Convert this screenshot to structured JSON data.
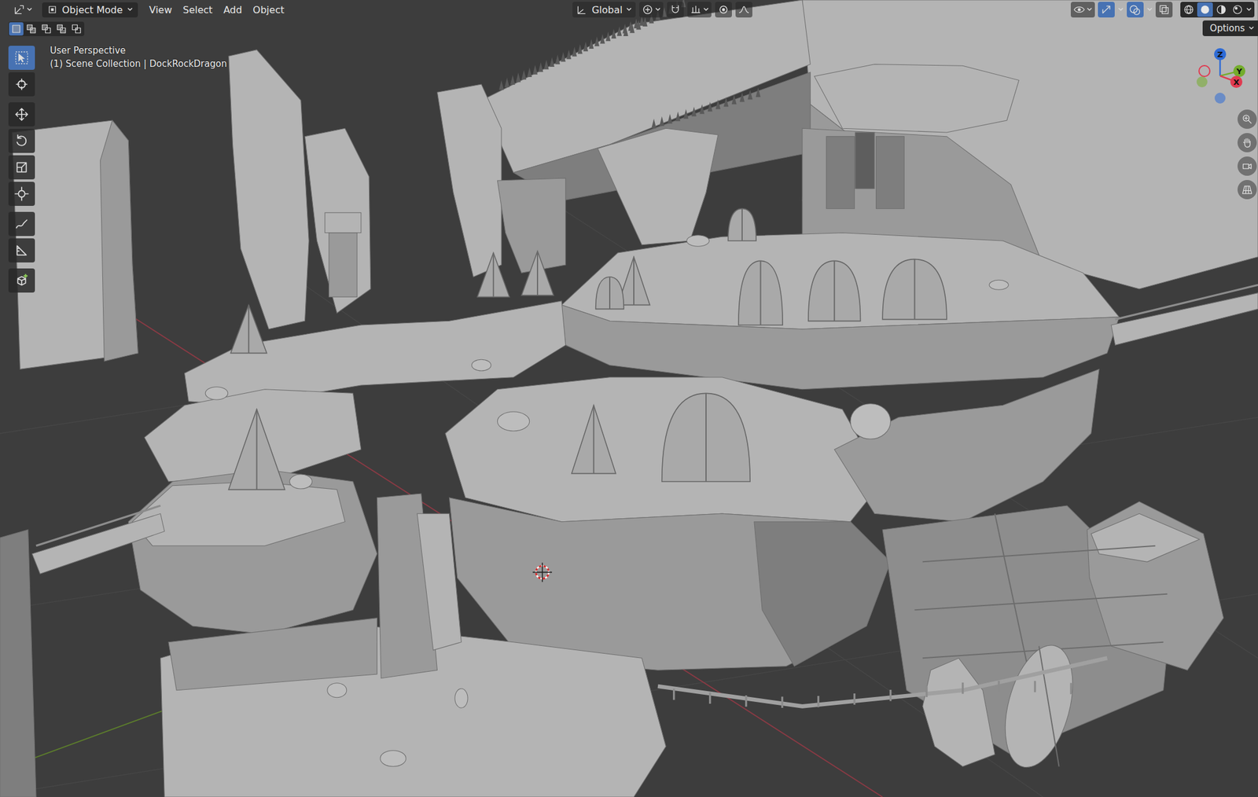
{
  "header": {
    "editor_type": {
      "expanded": false
    },
    "mode": "Object Mode",
    "menus": [
      "View",
      "Select",
      "Add",
      "Object"
    ],
    "orientation": "Global",
    "snap": {
      "on": false
    },
    "proportional_editing": {
      "on": false
    },
    "visibility": {
      "on": false
    },
    "gizmos": {
      "on": true
    },
    "overlays": {
      "on": true
    },
    "xray": {
      "on": false
    },
    "shading": [
      {
        "selected": false
      },
      {
        "selected": true
      },
      {
        "selected": false
      },
      {
        "selected": false
      }
    ]
  },
  "select_modes": [
    {
      "selected": true
    },
    {
      "selected": false
    },
    {
      "selected": false
    },
    {
      "selected": false
    },
    {
      "selected": false
    }
  ],
  "toolbar": [
    {
      "selected": true
    },
    {
      "selected": false
    },
    {
      "selected": false
    },
    {
      "selected": false
    },
    {
      "selected": false
    },
    {
      "selected": false
    },
    {
      "selected": false
    },
    {
      "selected": false
    },
    {
      "selected": false
    }
  ],
  "viewport": {
    "view": "User Perspective",
    "collection": "(1) Scene Collection | DockRockDragon",
    "options": "Options"
  },
  "gizmo": [
    {
      "label": "Z",
      "color": "#2e6bd6"
    },
    {
      "label": "Y",
      "color": "#74ad2c"
    },
    {
      "label": "X",
      "color": "#e03a50"
    }
  ]
}
